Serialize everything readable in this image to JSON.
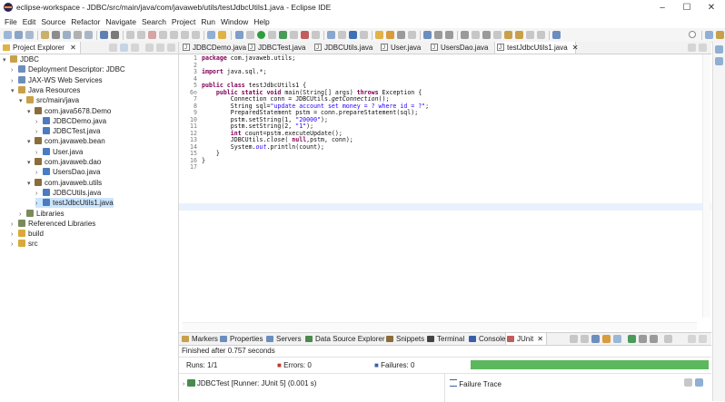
{
  "window": {
    "title": "eclipse-workspace - JDBC/src/main/java/com/javaweb/utils/testJdbcUtils1.java - Eclipse IDE",
    "minimize": "–",
    "maximize": "☐",
    "close": "✕"
  },
  "menu": [
    "File",
    "Edit",
    "Source",
    "Refactor",
    "Navigate",
    "Search",
    "Project",
    "Run",
    "Window",
    "Help"
  ],
  "explorer": {
    "tab_label": "Project Explorer",
    "tab_close": "✕",
    "tree": [
      {
        "label": "JDBC",
        "indent": 0,
        "arrow": "▾",
        "icon": "project-icon"
      },
      {
        "label": "Deployment Descriptor: JDBC",
        "indent": 1,
        "arrow": "›",
        "icon": "descriptor-icon"
      },
      {
        "label": "JAX-WS Web Services",
        "indent": 1,
        "arrow": "›",
        "icon": "webservice-icon"
      },
      {
        "label": "Java Resources",
        "indent": 1,
        "arrow": "▾",
        "icon": "java-resources-icon"
      },
      {
        "label": "src/main/java",
        "indent": 2,
        "arrow": "▾",
        "icon": "source-folder-icon"
      },
      {
        "label": "com.java5678.Demo",
        "indent": 3,
        "arrow": "▾",
        "icon": "package-icon"
      },
      {
        "label": "JDBCDemo.java",
        "indent": 4,
        "arrow": "›",
        "icon": "java-file-icon"
      },
      {
        "label": "JDBCTest.java",
        "indent": 4,
        "arrow": "›",
        "icon": "java-file-icon"
      },
      {
        "label": "com.javaweb.bean",
        "indent": 3,
        "arrow": "▾",
        "icon": "package-icon"
      },
      {
        "label": "User.java",
        "indent": 4,
        "arrow": "›",
        "icon": "java-file-icon"
      },
      {
        "label": "com.javaweb.dao",
        "indent": 3,
        "arrow": "▾",
        "icon": "package-icon"
      },
      {
        "label": "UsersDao.java",
        "indent": 4,
        "arrow": "›",
        "icon": "java-file-icon"
      },
      {
        "label": "com.javaweb.utils",
        "indent": 3,
        "arrow": "▾",
        "icon": "package-icon"
      },
      {
        "label": "JDBCUtils.java",
        "indent": 4,
        "arrow": "›",
        "icon": "java-file-icon"
      },
      {
        "label": "testJdbcUtils1.java",
        "indent": 4,
        "arrow": "›",
        "icon": "java-file-icon",
        "selected": true
      },
      {
        "label": "Libraries",
        "indent": 2,
        "arrow": "›",
        "icon": "library-icon"
      },
      {
        "label": "Referenced Libraries",
        "indent": 1,
        "arrow": "›",
        "icon": "library-icon"
      },
      {
        "label": "build",
        "indent": 1,
        "arrow": "›",
        "icon": "folder-icon"
      },
      {
        "label": "src",
        "indent": 1,
        "arrow": "›",
        "icon": "folder-icon"
      }
    ]
  },
  "editor": {
    "tabs": [
      "JDBCDemo.java",
      "JDBCTest.java",
      "JDBCUtils.java",
      "User.java",
      "UsersDao.java",
      "testJdbcUtils1.java"
    ],
    "active_tab": "testJdbcUtils1.java",
    "tab_close": "✕",
    "line_numbers": [
      "1",
      "2",
      "3",
      "4",
      "5",
      "6⊖",
      "7",
      "8",
      "9",
      "10",
      "11",
      "12",
      "13",
      "14",
      "15",
      "16",
      "17"
    ],
    "lines": [
      [
        {
          "t": "package",
          "c": "kw"
        },
        {
          "t": " com.javaweb.utils;"
        }
      ],
      [],
      [
        {
          "t": "import",
          "c": "kw"
        },
        {
          "t": " java.sql.*;"
        }
      ],
      [],
      [
        {
          "t": "public class",
          "c": "kw"
        },
        {
          "t": " testJdbcUtils1 {"
        }
      ],
      [
        {
          "t": "    "
        },
        {
          "t": "public static void",
          "c": "kw"
        },
        {
          "t": " main(String[] args) "
        },
        {
          "t": "throws",
          "c": "kw"
        },
        {
          "t": " Exception {"
        }
      ],
      [
        {
          "t": "        Connection conn = JDBCUtils."
        },
        {
          "t": "getConnection",
          "c": "it"
        },
        {
          "t": "();"
        }
      ],
      [
        {
          "t": "        String sql="
        },
        {
          "t": "\"update account set money = ? where id = ?\"",
          "c": "str"
        },
        {
          "t": ";"
        }
      ],
      [
        {
          "t": "        PreparedStatement pstm = conn.prepareStatement(sql);"
        }
      ],
      [
        {
          "t": "        pstm.setString(1, "
        },
        {
          "t": "\"20000\"",
          "c": "str"
        },
        {
          "t": ");"
        }
      ],
      [
        {
          "t": "        pstm.setString(2, "
        },
        {
          "t": "\"1\"",
          "c": "str"
        },
        {
          "t": ");"
        }
      ],
      [
        {
          "t": "        "
        },
        {
          "t": "int",
          "c": "kw"
        },
        {
          "t": " count=pstm.executeUpdate();"
        }
      ],
      [
        {
          "t": "        JDBCUtils."
        },
        {
          "t": "close",
          "c": "it"
        },
        {
          "t": "( "
        },
        {
          "t": "null",
          "c": "kw"
        },
        {
          "t": ",pstm, conn);"
        }
      ],
      [
        {
          "t": "        System."
        },
        {
          "t": "out",
          "c": "it str"
        },
        {
          "t": ".println(count);"
        }
      ],
      [
        {
          "t": "    }"
        }
      ],
      [
        {
          "t": "}"
        }
      ],
      []
    ]
  },
  "bottom": {
    "tabs": [
      "Markers",
      "Properties",
      "Servers",
      "Data Source Explorer",
      "Snippets",
      "Terminal",
      "Console",
      "JUnit"
    ],
    "active_tab": "JUnit",
    "tab_close": "✕",
    "status": "Finished after 0.757 seconds",
    "runs_label": "Runs:",
    "runs_value": "1/1",
    "errors_label": "Errors:",
    "errors_value": "0",
    "failures_label": "Failures:",
    "failures_value": "0",
    "progress": 1.0,
    "progress_color": "#5cb85c",
    "result_item": "JDBCTest [Runner: JUnit 5] (0.001 s)",
    "failure_trace_label": "Failure Trace"
  }
}
